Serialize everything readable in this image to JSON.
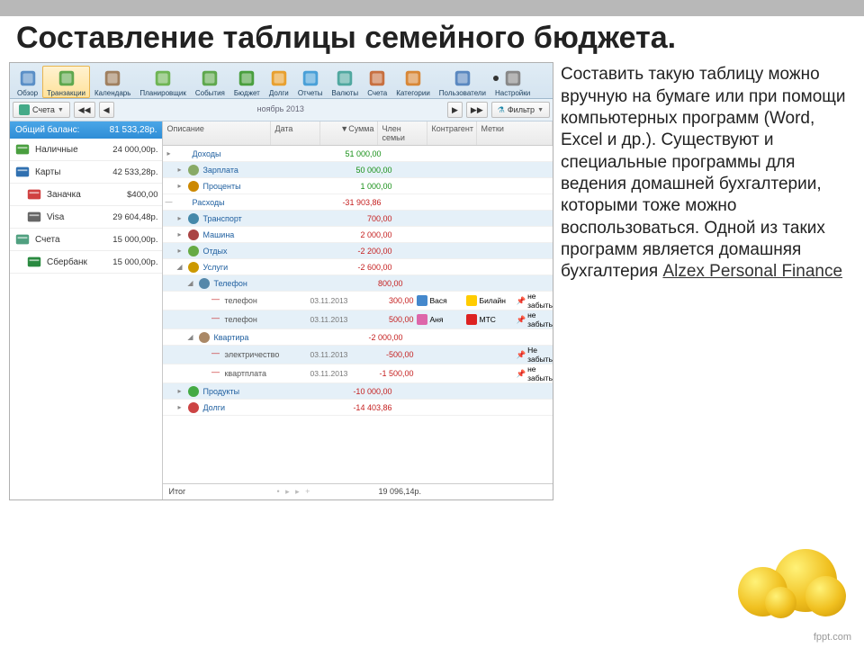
{
  "slide": {
    "title": "Составление таблицы семейного бюджета.",
    "narrative": "Составить такую таблицу можно вручную на бумаге или при помощи компьютерных программ (Word, Excel и др.). Существуют и специальные программы для ведения домашней бухгалтерии, которыми тоже можно воспользоваться. Одной из таких программ является домашняя бухгалтерия ",
    "link": "Alzex Personal Finance",
    "watermark": "fppt.com"
  },
  "toolbar": [
    {
      "label": "Обзор",
      "icon": "overview"
    },
    {
      "label": "Транзакции",
      "icon": "transactions",
      "selected": true
    },
    {
      "label": "Календарь",
      "icon": "calendar"
    },
    {
      "label": "Планировщик",
      "icon": "planner"
    },
    {
      "label": "События",
      "icon": "events"
    },
    {
      "label": "Бюджет",
      "icon": "budget"
    },
    {
      "label": "Долги",
      "icon": "debts"
    },
    {
      "label": "Отчеты",
      "icon": "reports"
    },
    {
      "label": "Валюты",
      "icon": "currency"
    },
    {
      "label": "Счета",
      "icon": "accounts"
    },
    {
      "label": "Категории",
      "icon": "categories"
    },
    {
      "label": "Пользователи",
      "icon": "users"
    },
    {
      "label": "Настройки",
      "icon": "settings"
    }
  ],
  "subbar": {
    "accounts": "Счета",
    "month": "ноябрь 2013",
    "filter": "Фильтр"
  },
  "sidebar": {
    "head_label": "Общий баланс:",
    "head_value": "81 533,28р.",
    "items": [
      {
        "name": "Наличные",
        "value": "24 000,00р.",
        "icon": "cash"
      },
      {
        "name": "Карты",
        "value": "42 533,28р.",
        "icon": "cards"
      },
      {
        "name": "Заначка",
        "value": "$400,00",
        "icon": "piggy",
        "sub": true
      },
      {
        "name": "Visa",
        "value": "29 604,48р.",
        "icon": "visa",
        "sub": true
      },
      {
        "name": "Счета",
        "value": "15 000,00р.",
        "icon": "bank"
      },
      {
        "name": "Сбербанк",
        "value": "15 000,00р.",
        "icon": "sber",
        "sub": true
      }
    ]
  },
  "columns": {
    "desc": "Описание",
    "date": "Дата",
    "sum": "▼Сумма",
    "member": "Член семьи",
    "agent": "Контрагент",
    "marks": "Метки"
  },
  "rows": [
    {
      "type": "group",
      "exp": "▸",
      "desc": "Доходы",
      "sum": "51 000,00",
      "pos": true,
      "alt": false
    },
    {
      "type": "cat",
      "indent": 1,
      "exp": "▸",
      "desc": "Зарплата",
      "sum": "50 000,00",
      "pos": true,
      "alt": true,
      "icon": "wallet"
    },
    {
      "type": "cat",
      "indent": 1,
      "exp": "▸",
      "desc": "Проценты",
      "sum": "1 000,00",
      "pos": true,
      "alt": false,
      "icon": "percent"
    },
    {
      "type": "group",
      "exp": "—",
      "desc": "Расходы",
      "sum": "-31 903,86",
      "neg": true,
      "alt": false
    },
    {
      "type": "cat",
      "indent": 1,
      "exp": "▸",
      "desc": "Транспорт",
      "sum": "700,00",
      "neg": true,
      "alt": true,
      "icon": "bus"
    },
    {
      "type": "cat",
      "indent": 1,
      "exp": "▸",
      "desc": "Машина",
      "sum": "2 000,00",
      "neg": true,
      "alt": false,
      "icon": "car"
    },
    {
      "type": "cat",
      "indent": 1,
      "exp": "▸",
      "desc": "Отдых",
      "sum": "-2 200,00",
      "neg": true,
      "alt": true,
      "icon": "rest"
    },
    {
      "type": "cat",
      "indent": 1,
      "exp": "◢",
      "desc": "Услуги",
      "sum": "-2 600,00",
      "neg": true,
      "alt": false,
      "icon": "service"
    },
    {
      "type": "cat",
      "indent": 2,
      "exp": "◢",
      "desc": "Телефон",
      "sum": "800,00",
      "neg": true,
      "alt": true,
      "icon": "phone"
    },
    {
      "type": "item",
      "indent": 3,
      "desc": "телефон",
      "date": "03.11.2013",
      "sum": "300,00",
      "neg": true,
      "alt": false,
      "member": "Вася",
      "agent": "Билайн",
      "mark": "не забыть",
      "memico": "boy",
      "agentico": "bee"
    },
    {
      "type": "item",
      "indent": 3,
      "desc": "телефон",
      "date": "03.11.2013",
      "sum": "500,00",
      "neg": true,
      "alt": true,
      "member": "Аня",
      "agent": "МТС",
      "mark": "не забыть",
      "memico": "girl",
      "agentico": "mts"
    },
    {
      "type": "cat",
      "indent": 2,
      "exp": "◢",
      "desc": "Квартира",
      "sum": "-2 000,00",
      "neg": true,
      "alt": false,
      "icon": "house"
    },
    {
      "type": "item",
      "indent": 3,
      "desc": "электричество",
      "date": "03.11.2013",
      "sum": "-500,00",
      "neg": true,
      "alt": true,
      "mark": "Не забыть"
    },
    {
      "type": "item",
      "indent": 3,
      "desc": "квартплата",
      "date": "03.11.2013",
      "sum": "-1 500,00",
      "neg": true,
      "alt": false,
      "mark": "не забыть"
    },
    {
      "type": "cat",
      "indent": 1,
      "exp": "▸",
      "desc": "Продукты",
      "sum": "-10 000,00",
      "neg": true,
      "alt": true,
      "icon": "food"
    },
    {
      "type": "cat",
      "indent": 1,
      "exp": "▸",
      "desc": "Долги",
      "sum": "-14 403,86",
      "neg": true,
      "alt": false,
      "icon": "debt"
    }
  ],
  "footer": {
    "label": "Итог",
    "total": "19 096,14р."
  }
}
